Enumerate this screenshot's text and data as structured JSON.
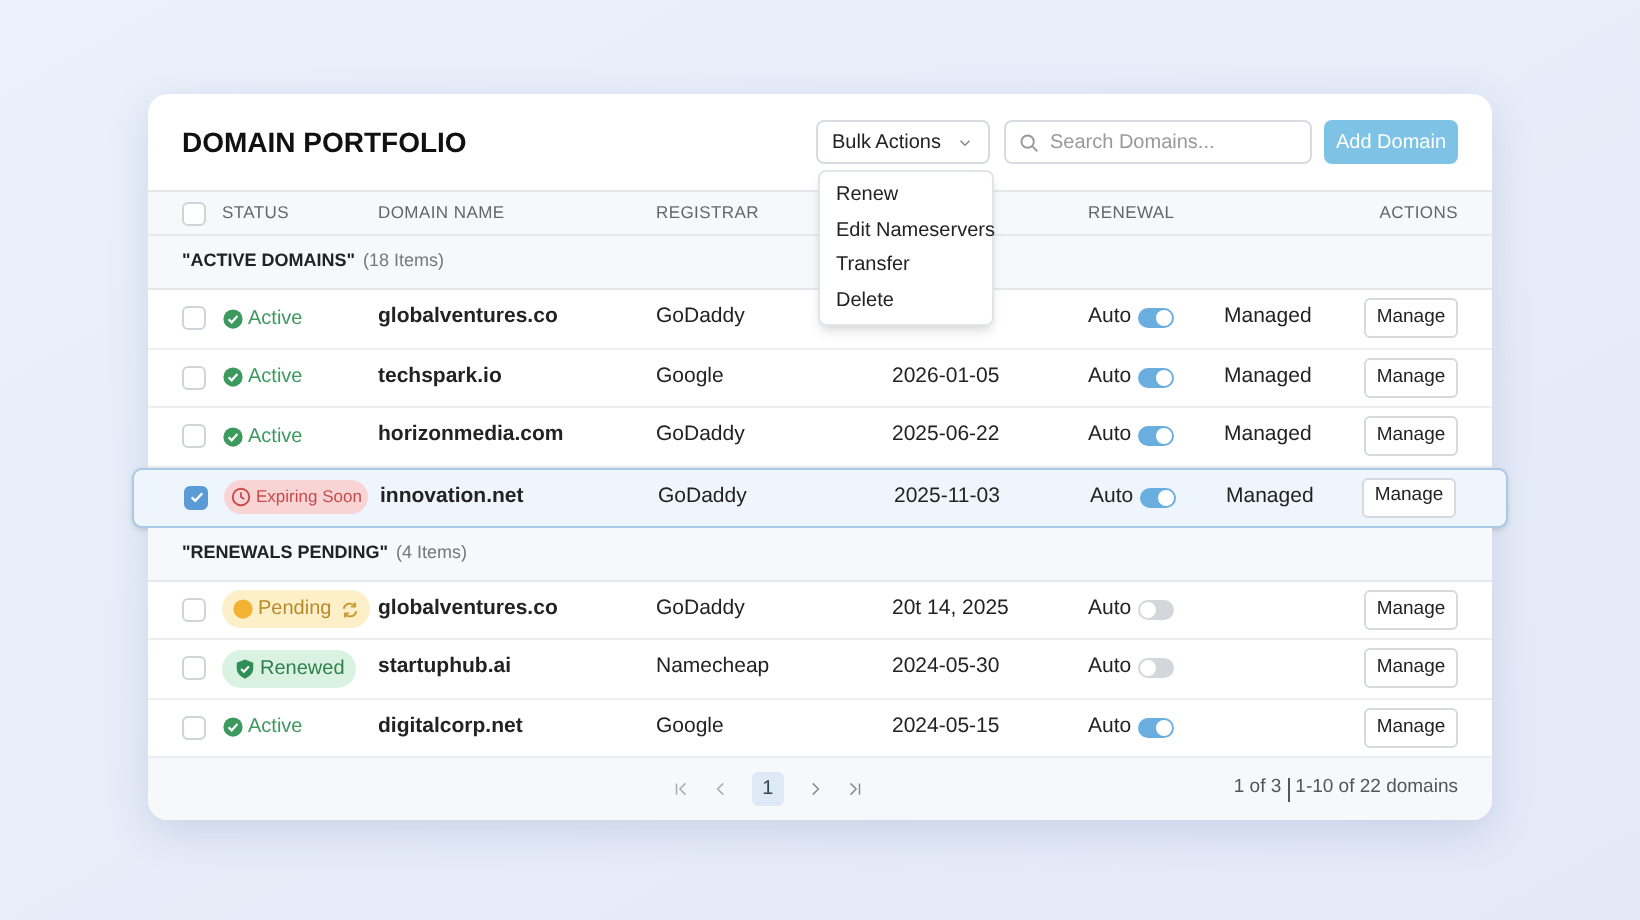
{
  "title": "DOMAIN PORTFOLIO",
  "bulk_actions": {
    "label": "Bulk Actions",
    "expanded": true,
    "options": [
      "Renew",
      "Edit Nameservers",
      "Transfer",
      "Delete"
    ]
  },
  "search": {
    "placeholder": "Search Domains..."
  },
  "add_button": "Add Domain",
  "columns": [
    {
      "label": "STATUS"
    },
    {
      "label": "DOMAIN NAME"
    },
    {
      "label": "REGISTRAR"
    },
    {
      "label": "RENEWAL"
    },
    {
      "label": "ACTIONS"
    }
  ],
  "header_checked": false,
  "groups": [
    {
      "name": "\"ACTIVE DOMAINS\"",
      "count": "(18 Items)",
      "rows": [
        {
          "checked": false,
          "selected": false,
          "status": {
            "kind": "active",
            "label": "Active"
          },
          "domain": "globalventures.co",
          "registrar": "GoDaddy",
          "renewal_label": "Auto",
          "auto_renew": true,
          "management": "Managed",
          "action": "Manage"
        },
        {
          "checked": false,
          "selected": false,
          "status": {
            "kind": "active",
            "label": "Active"
          },
          "domain": "techspark.io",
          "registrar": "Google",
          "expiry": "2026-01-05",
          "renewal_label": "Auto",
          "auto_renew": true,
          "management": "Managed",
          "action": "Manage"
        },
        {
          "checked": false,
          "selected": false,
          "status": {
            "kind": "active",
            "label": "Active"
          },
          "domain": "horizonmedia.com",
          "registrar": "GoDaddy",
          "expiry": "2025-06-22",
          "renewal_label": "Auto",
          "auto_renew": true,
          "management": "Managed",
          "action": "Manage"
        },
        {
          "checked": true,
          "selected": true,
          "status": {
            "kind": "expiring",
            "label": "Expiring Soon"
          },
          "domain": "innovation.net",
          "registrar": "GoDaddy",
          "expiry": "2025-11-03",
          "renewal_label": "Auto",
          "auto_renew": true,
          "management": "Managed",
          "action": "Manage"
        }
      ]
    },
    {
      "name": "\"RENEWALS PENDING\"",
      "count": "(4 Items)",
      "rows": [
        {
          "checked": false,
          "selected": false,
          "status": {
            "kind": "pending",
            "label": "Pending"
          },
          "domain": "globalventures.co",
          "registrar": "GoDaddy",
          "expiry": "20t 14, 2025",
          "renewal_label": "Auto",
          "auto_renew": false,
          "action": "Manage"
        },
        {
          "checked": false,
          "selected": false,
          "status": {
            "kind": "renewed",
            "label": "Renewed"
          },
          "domain": "startuphub.ai",
          "registrar": "Namecheap",
          "expiry": "2024-05-30",
          "renewal_label": "Auto",
          "auto_renew": false,
          "action": "Manage"
        },
        {
          "checked": false,
          "selected": false,
          "status": {
            "kind": "active",
            "label": "Active"
          },
          "domain": "digitalcorp.net",
          "registrar": "Google",
          "expiry": "2024-05-15",
          "renewal_label": "Auto",
          "auto_renew": true,
          "action": "Manage"
        }
      ]
    }
  ],
  "pagination": {
    "pages": [
      {
        "label": "1",
        "selected": true
      }
    ],
    "summary": "1 of 3",
    "range": "1-10 of 22 domains"
  }
}
